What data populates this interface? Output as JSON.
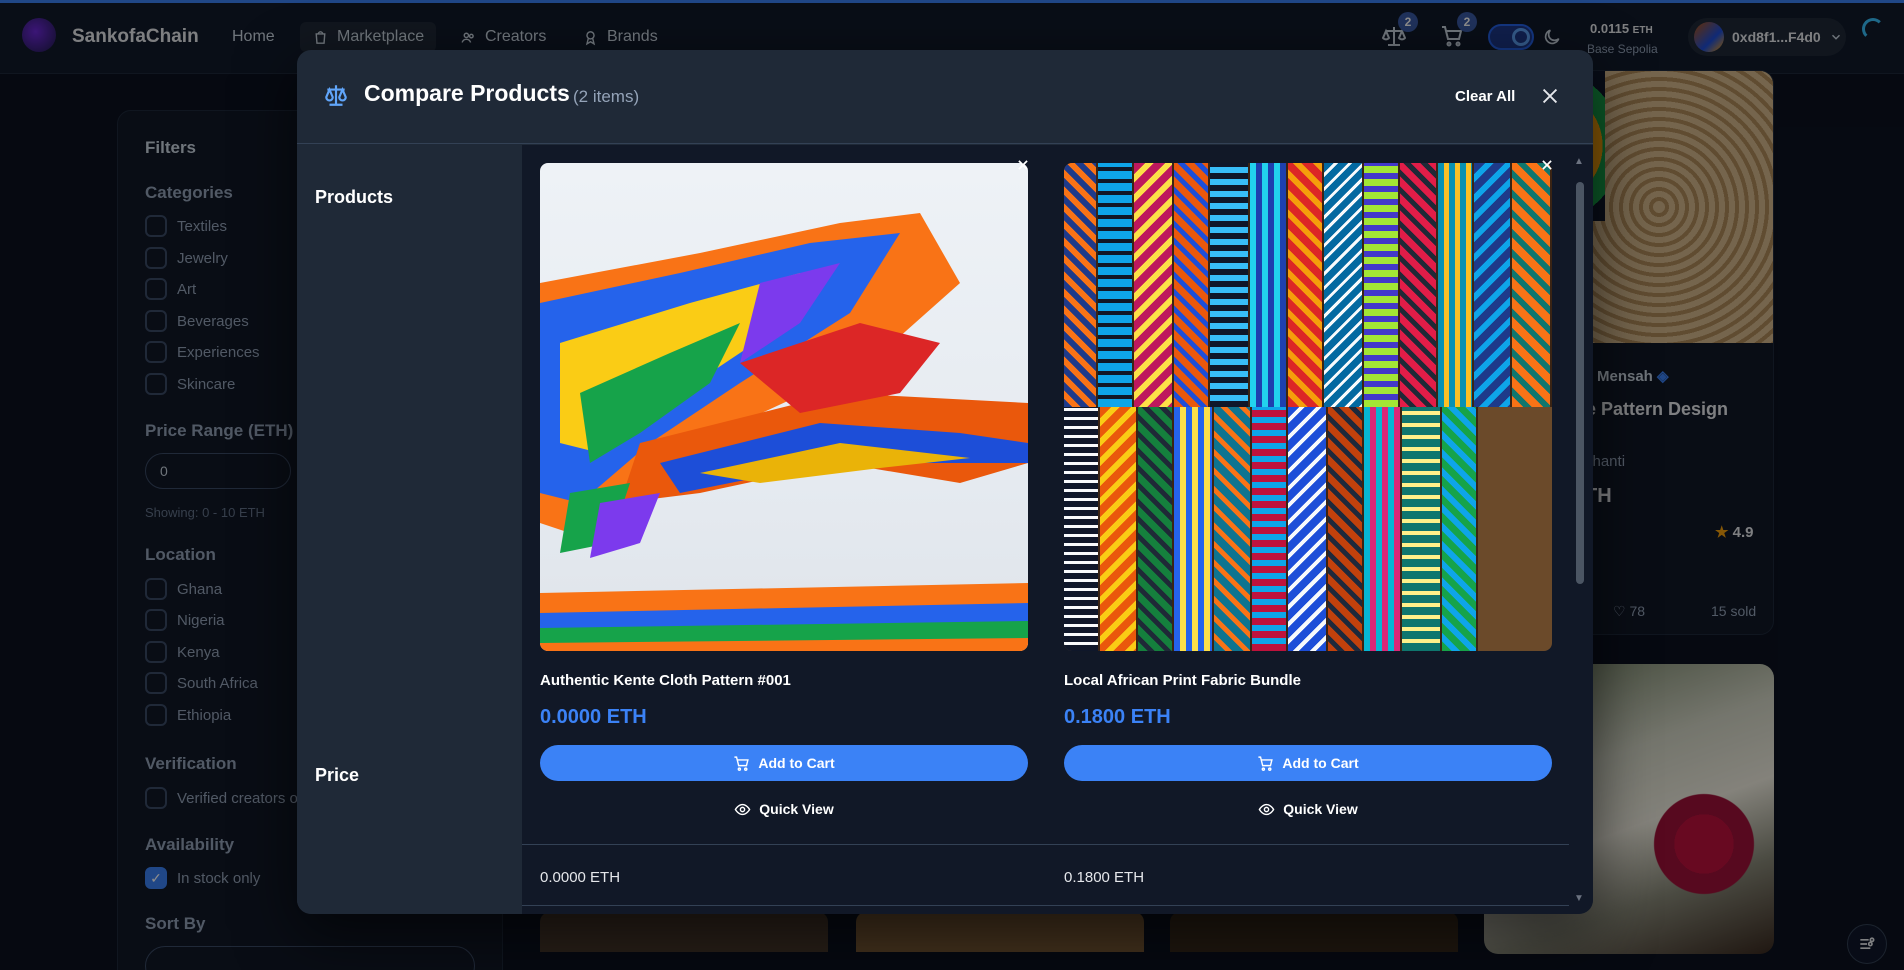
{
  "app": {
    "brand": "SankofaChain",
    "nav": [
      {
        "label": "Home"
      },
      {
        "label": "Marketplace"
      },
      {
        "label": "Creators"
      },
      {
        "label": "Brands"
      }
    ],
    "compare_badge": "2",
    "cart_badge": "2",
    "balance_value": "0.0115",
    "balance_unit": "ETH",
    "network": "Base Sepolia",
    "wallet": "0xd8f1...F4d0"
  },
  "filters": {
    "title": "Filters",
    "categories_title": "Categories",
    "categories": [
      "Textiles",
      "Jewelry",
      "Art",
      "Beverages",
      "Experiences",
      "Skincare"
    ],
    "price_title": "Price Range (ETH)",
    "price_min": "0",
    "price_note": "Showing: 0 - 10 ETH",
    "location_title": "Location",
    "locations": [
      "Ghana",
      "Nigeria",
      "Kenya",
      "South Africa",
      "Ethiopia"
    ],
    "verification_title": "Verification",
    "verified_label": "Verified creators o",
    "availability_title": "Availability",
    "in_stock_label": "In stock only",
    "sort_title": "Sort By"
  },
  "bg_card": {
    "creator": "Mensah",
    "title": "e Pattern Design",
    "location": "shanti",
    "price": "TH",
    "rating": "4.9",
    "likes": "78",
    "sold": "15 sold"
  },
  "modal": {
    "title": "Compare Products",
    "count": "(2 items)",
    "clear_all": "Clear All",
    "rows": {
      "products": "Products",
      "price": "Price"
    },
    "add_to_cart": "Add to Cart",
    "quick_view": "Quick View",
    "items": [
      {
        "name": "Authentic Kente Cloth Pattern #001",
        "price": "0.0000 ETH",
        "price_row": "0.0000 ETH"
      },
      {
        "name": "Local African Print Fabric Bundle",
        "price": "0.1800 ETH",
        "price_row": "0.1800 ETH"
      }
    ]
  },
  "colors": {
    "accent": "#3b82f6",
    "background": "#0b1220",
    "modal": "#1f2937",
    "modal_content": "#111827"
  },
  "icons": [
    "scale-icon",
    "cart-icon",
    "moon-icon",
    "chevron-down-icon",
    "close-icon",
    "eye-icon",
    "home-icon",
    "bag-icon",
    "users-icon",
    "award-icon",
    "star-icon",
    "heart-icon",
    "shield-check-icon",
    "settings-icon"
  ]
}
